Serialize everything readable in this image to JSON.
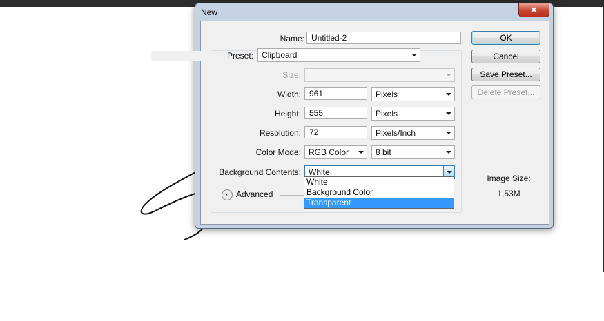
{
  "window": {
    "title": "New",
    "close_glyph": "✕"
  },
  "form": {
    "name": {
      "label": "Name:",
      "value": "Untitled-2"
    },
    "preset": {
      "label": "Preset:",
      "value": "Clipboard"
    },
    "size": {
      "label": "Size:",
      "value": ""
    },
    "width": {
      "label": "Width:",
      "value": "961",
      "unit": "Pixels"
    },
    "height": {
      "label": "Height:",
      "value": "555",
      "unit": "Pixels"
    },
    "resolution": {
      "label": "Resolution:",
      "value": "72",
      "unit": "Pixels/Inch"
    },
    "color_mode": {
      "label": "Color Mode:",
      "value": "RGB Color",
      "depth": "8 bit"
    },
    "background": {
      "label": "Background Contents:",
      "value": "White",
      "options": [
        "White",
        "Background Color",
        "Transparent"
      ],
      "highlighted": "Transparent"
    },
    "advanced": {
      "label": "Advanced",
      "icon": "double-chevron-down-icon"
    }
  },
  "buttons": {
    "ok": "OK",
    "cancel": "Cancel",
    "save_preset": "Save Preset...",
    "delete_preset": "Delete Preset..."
  },
  "image_size": {
    "label": "Image Size:",
    "value": "1,53M"
  },
  "colors": {
    "title_bar": "#c4d2e4",
    "close_button": "#c9452f",
    "selection": "#3399ff",
    "dialog_body": "#f0f0f0"
  }
}
